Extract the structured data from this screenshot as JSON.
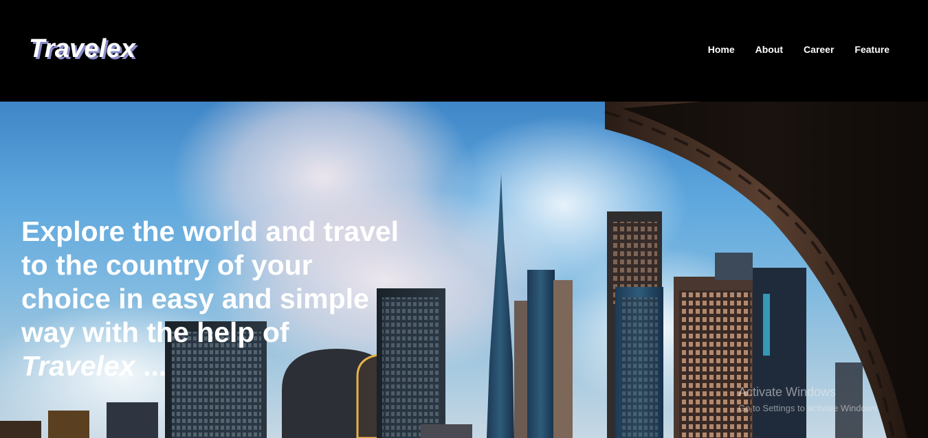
{
  "header": {
    "logo": "Travelex",
    "nav": [
      {
        "label": "Home"
      },
      {
        "label": "About"
      },
      {
        "label": "Career"
      },
      {
        "label": "Feature"
      }
    ]
  },
  "hero": {
    "line1": "Explore the world and travel",
    "line2": "to the country of your",
    "line3": "choice in easy and simple",
    "line4": "way with the help of",
    "brand": "Travelex",
    "suffix": " ..."
  },
  "watermark": {
    "title": "Activate Windows",
    "subtitle": "Go to Settings to activate Windows."
  },
  "colors": {
    "header_bg": "#000000",
    "text": "#ffffff",
    "logo_shadow": "#8a8cc9"
  }
}
